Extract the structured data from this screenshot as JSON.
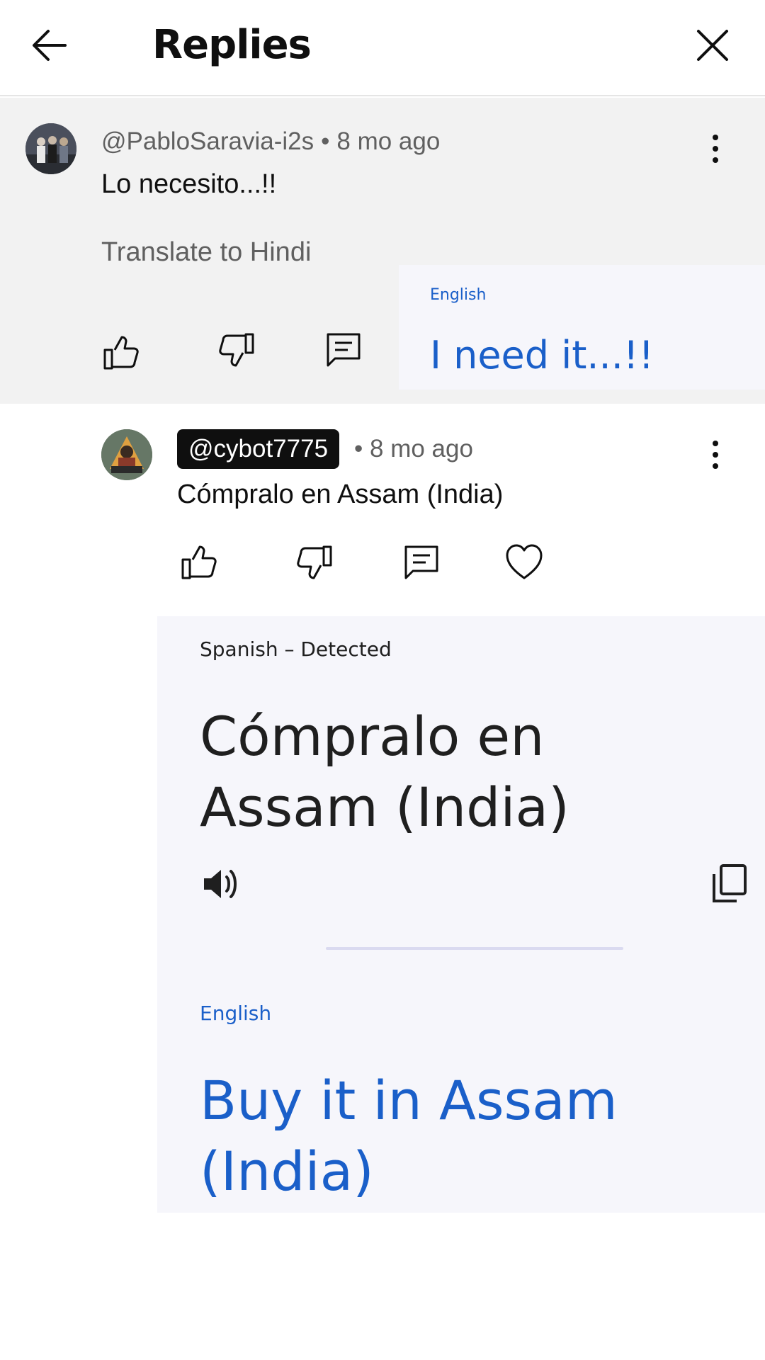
{
  "header": {
    "title": "Replies"
  },
  "parent_comment": {
    "author": "@PabloSaravia-i2s",
    "separator": "•",
    "time": "8 mo ago",
    "text": "Lo necesito...!!",
    "translate_link": "Translate to Hindi",
    "popup": {
      "language": "English",
      "translation": "I need it...!!"
    }
  },
  "reply": {
    "author": "@cybot7775",
    "separator": "•",
    "time": "8 mo ago",
    "text": "Cómpralo en Assam (India)"
  },
  "translation_panel": {
    "source_language": "Spanish – Detected",
    "source_text": "Cómpralo en Assam (India)",
    "target_language": "English",
    "target_text": "Buy it in Assam (India)"
  },
  "colors": {
    "accent_blue": "#1a5fc9",
    "heart_red": "#ff0033",
    "parent_bg": "#f2f2f2",
    "panel_bg": "#f6f6fb"
  }
}
